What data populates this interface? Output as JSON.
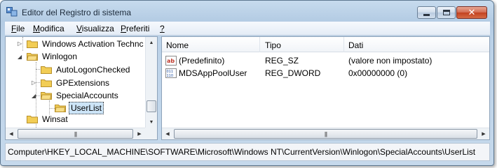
{
  "window": {
    "title": "Editor del Registro di sistema"
  },
  "menu": [
    {
      "accel": "F",
      "rest": "ile"
    },
    {
      "accel": "M",
      "rest": "odifica"
    },
    {
      "accel": "V",
      "rest": "isualizza"
    },
    {
      "accel": "P",
      "rest": "referiti"
    },
    {
      "accel": "?",
      "rest": ""
    }
  ],
  "tree": {
    "items": [
      {
        "label": "Windows Activation Technc",
        "expander": "▷"
      },
      {
        "label": "Winlogon",
        "expander": "◢"
      },
      {
        "label": "AutoLogonChecked",
        "expander": ""
      },
      {
        "label": "GPExtensions",
        "expander": "▷"
      },
      {
        "label": "SpecialAccounts",
        "expander": "◢"
      },
      {
        "label": "UserList",
        "expander": ""
      },
      {
        "label": "Winsat",
        "expander": ""
      }
    ],
    "scroll_up": "▲",
    "scroll_down": "▼",
    "scroll_left": "◀",
    "scroll_right": "▶",
    "grip": "|||"
  },
  "list": {
    "columns": {
      "name": "Nome",
      "type": "Tipo",
      "data": "Dati"
    },
    "rows": [
      {
        "icon": "string-value-icon",
        "name": "(Predefinito)",
        "type": "REG_SZ",
        "data": "(valore non impostato)"
      },
      {
        "icon": "binary-value-icon",
        "name": "MDSAppPoolUser",
        "type": "REG_DWORD",
        "data": "0x00000000 (0)"
      }
    ],
    "grip": "|||"
  },
  "status": {
    "path": "Computer\\HKEY_LOCAL_MACHINE\\SOFTWARE\\Microsoft\\Windows NT\\CurrentVersion\\Winlogon\\SpecialAccounts\\UserList"
  },
  "colors": {
    "folder": "#f2cd55",
    "selection": "#cce4f7",
    "close_button": "#c2401f"
  }
}
